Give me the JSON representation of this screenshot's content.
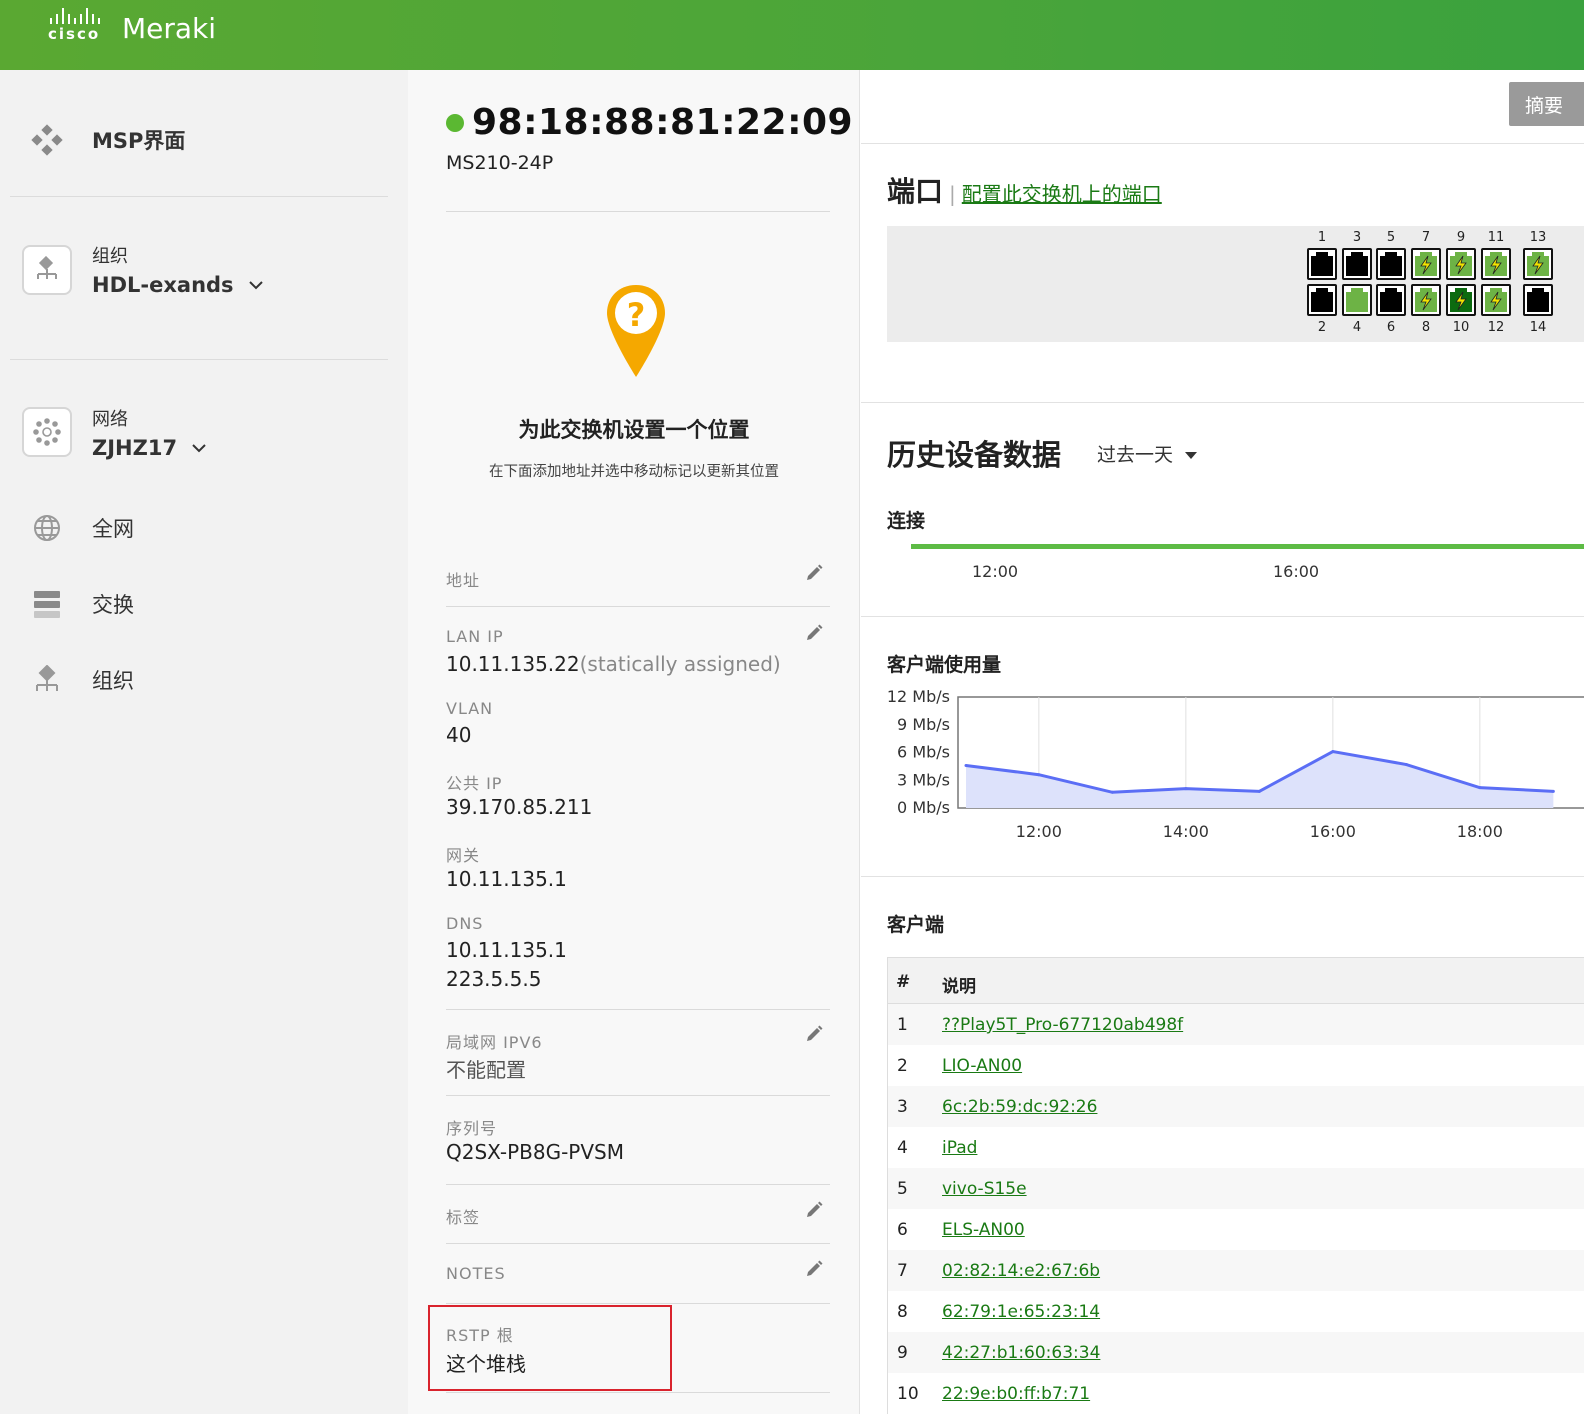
{
  "brand": {
    "company": "cisco",
    "product": "Meraki",
    "accent": "#4aa53a"
  },
  "sidebar": {
    "msp_label": "MSP界面",
    "org": {
      "caption": "组织",
      "name": "HDL-exands"
    },
    "network": {
      "caption": "网络",
      "name": "ZJHZ17"
    },
    "items": [
      {
        "label": "全网",
        "icon": "globe-icon"
      },
      {
        "label": "交换",
        "icon": "switch-icon"
      },
      {
        "label": "组织",
        "icon": "organization-icon"
      }
    ]
  },
  "device": {
    "name": "98:18:88:81:22:09",
    "model": "MS210-24P",
    "status_color": "#5bb832",
    "location_title": "为此交换机设置一个位置",
    "location_hint": "在下面添加地址并选中移动标记以更新其位置",
    "fields": {
      "address_label": "地址",
      "lan_ip_label": "LAN IP",
      "lan_ip_value": "10.11.135.22",
      "lan_ip_note": "(statically assigned)",
      "vlan_label": "VLAN",
      "vlan_value": "40",
      "public_ip_label": "公共 IP",
      "public_ip_value": "39.170.85.211",
      "gateway_label": "网关",
      "gateway_value": "10.11.135.1",
      "dns_label": "DNS",
      "dns_value_1": "10.11.135.1",
      "dns_value_2": "223.5.5.5",
      "ipv6_label": "局域网 IPV6",
      "ipv6_value": "不能配置",
      "serial_label": "序列号",
      "serial_value": "Q2SX-PB8G-PVSM",
      "tags_label": "标签",
      "notes_label": "NOTES",
      "rstp_label": "RSTP 根",
      "rstp_value": "这个堆栈"
    }
  },
  "summary_button": "摘要",
  "ports": {
    "title": "端口",
    "configure_link": "配置此交换机上的端口",
    "top": [
      {
        "num": "1",
        "state": "disconnected"
      },
      {
        "num": "3",
        "state": "disconnected"
      },
      {
        "num": "5",
        "state": "disconnected"
      },
      {
        "num": "7",
        "state": "poe"
      },
      {
        "num": "9",
        "state": "poe"
      },
      {
        "num": "11",
        "state": "poe"
      },
      {
        "num": "13",
        "state": "poe"
      }
    ],
    "bottom": [
      {
        "num": "2",
        "state": "disconnected"
      },
      {
        "num": "4",
        "state": "connected"
      },
      {
        "num": "6",
        "state": "disconnected"
      },
      {
        "num": "8",
        "state": "poe"
      },
      {
        "num": "10",
        "state": "poe-dark"
      },
      {
        "num": "12",
        "state": "poe"
      },
      {
        "num": "14",
        "state": "disconnected"
      }
    ]
  },
  "history": {
    "title": "历史设备数据",
    "range": "过去一天",
    "connectivity_title": "连接",
    "connectivity_ticks": [
      "12:00",
      "16:00"
    ],
    "usage_title": "客户端使用量",
    "clients_title": "客户端"
  },
  "chart_data": {
    "type": "area",
    "title": "客户端使用量",
    "ylabel": "",
    "ylim": [
      0,
      12
    ],
    "y_ticks": [
      "12 Mb/s",
      "9 Mb/s",
      "6 Mb/s",
      "3 Mb/s",
      "0 Mb/s"
    ],
    "x_ticks": [
      "12:00",
      "14:00",
      "16:00",
      "18:00"
    ],
    "x": [
      "11:00",
      "12:00",
      "13:00",
      "14:00",
      "15:00",
      "16:00",
      "17:00",
      "18:00",
      "19:00"
    ],
    "values": [
      4.6,
      3.6,
      1.7,
      2.1,
      1.8,
      6.1,
      4.7,
      2.2,
      1.8
    ],
    "color": "#5b6ef5",
    "fill": "#dde2fb"
  },
  "clients_table": {
    "headers": [
      "#",
      "说明"
    ],
    "rows": [
      {
        "num": "1",
        "desc": "??Play5T_Pro-677120ab498f"
      },
      {
        "num": "2",
        "desc": "LIO-AN00"
      },
      {
        "num": "3",
        "desc": "6c:2b:59:dc:92:26"
      },
      {
        "num": "4",
        "desc": "iPad"
      },
      {
        "num": "5",
        "desc": "vivo-S15e"
      },
      {
        "num": "6",
        "desc": "ELS-AN00"
      },
      {
        "num": "7",
        "desc": "02:82:14:e2:67:6b"
      },
      {
        "num": "8",
        "desc": "62:79:1e:65:23:14"
      },
      {
        "num": "9",
        "desc": "42:27:b1:60:63:34"
      },
      {
        "num": "10",
        "desc": "22:9e:b0:ff:b7:71"
      }
    ]
  }
}
